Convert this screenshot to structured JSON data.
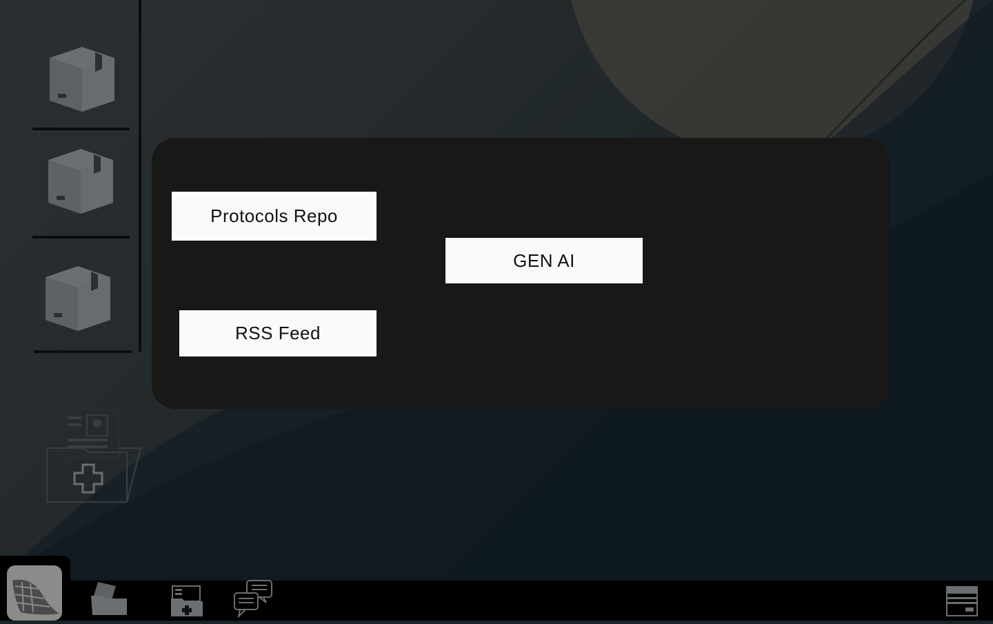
{
  "panel": {
    "buttons": {
      "protocols_repo": "Protocols Repo",
      "gen_ai": "GEN AI",
      "rss_feed": "RSS Feed"
    }
  },
  "sidebar": {
    "items": [
      {
        "icon": "package-box-icon"
      },
      {
        "icon": "package-box-icon"
      },
      {
        "icon": "package-box-icon"
      }
    ],
    "extra_icon": "medical-folder-icon"
  },
  "taskbar": {
    "items": [
      {
        "icon": "app-logo-icon",
        "active": true
      },
      {
        "icon": "folder-files-icon"
      },
      {
        "icon": "medical-id-card-icon"
      },
      {
        "icon": "chat-bubbles-icon"
      }
    ],
    "right_icon": "card-window-icon"
  },
  "colors": {
    "panel_bg": "#181817",
    "button_bg": "#fafaf8",
    "icon_gray": "#5f6466",
    "taskbar_bg": "#000000"
  }
}
